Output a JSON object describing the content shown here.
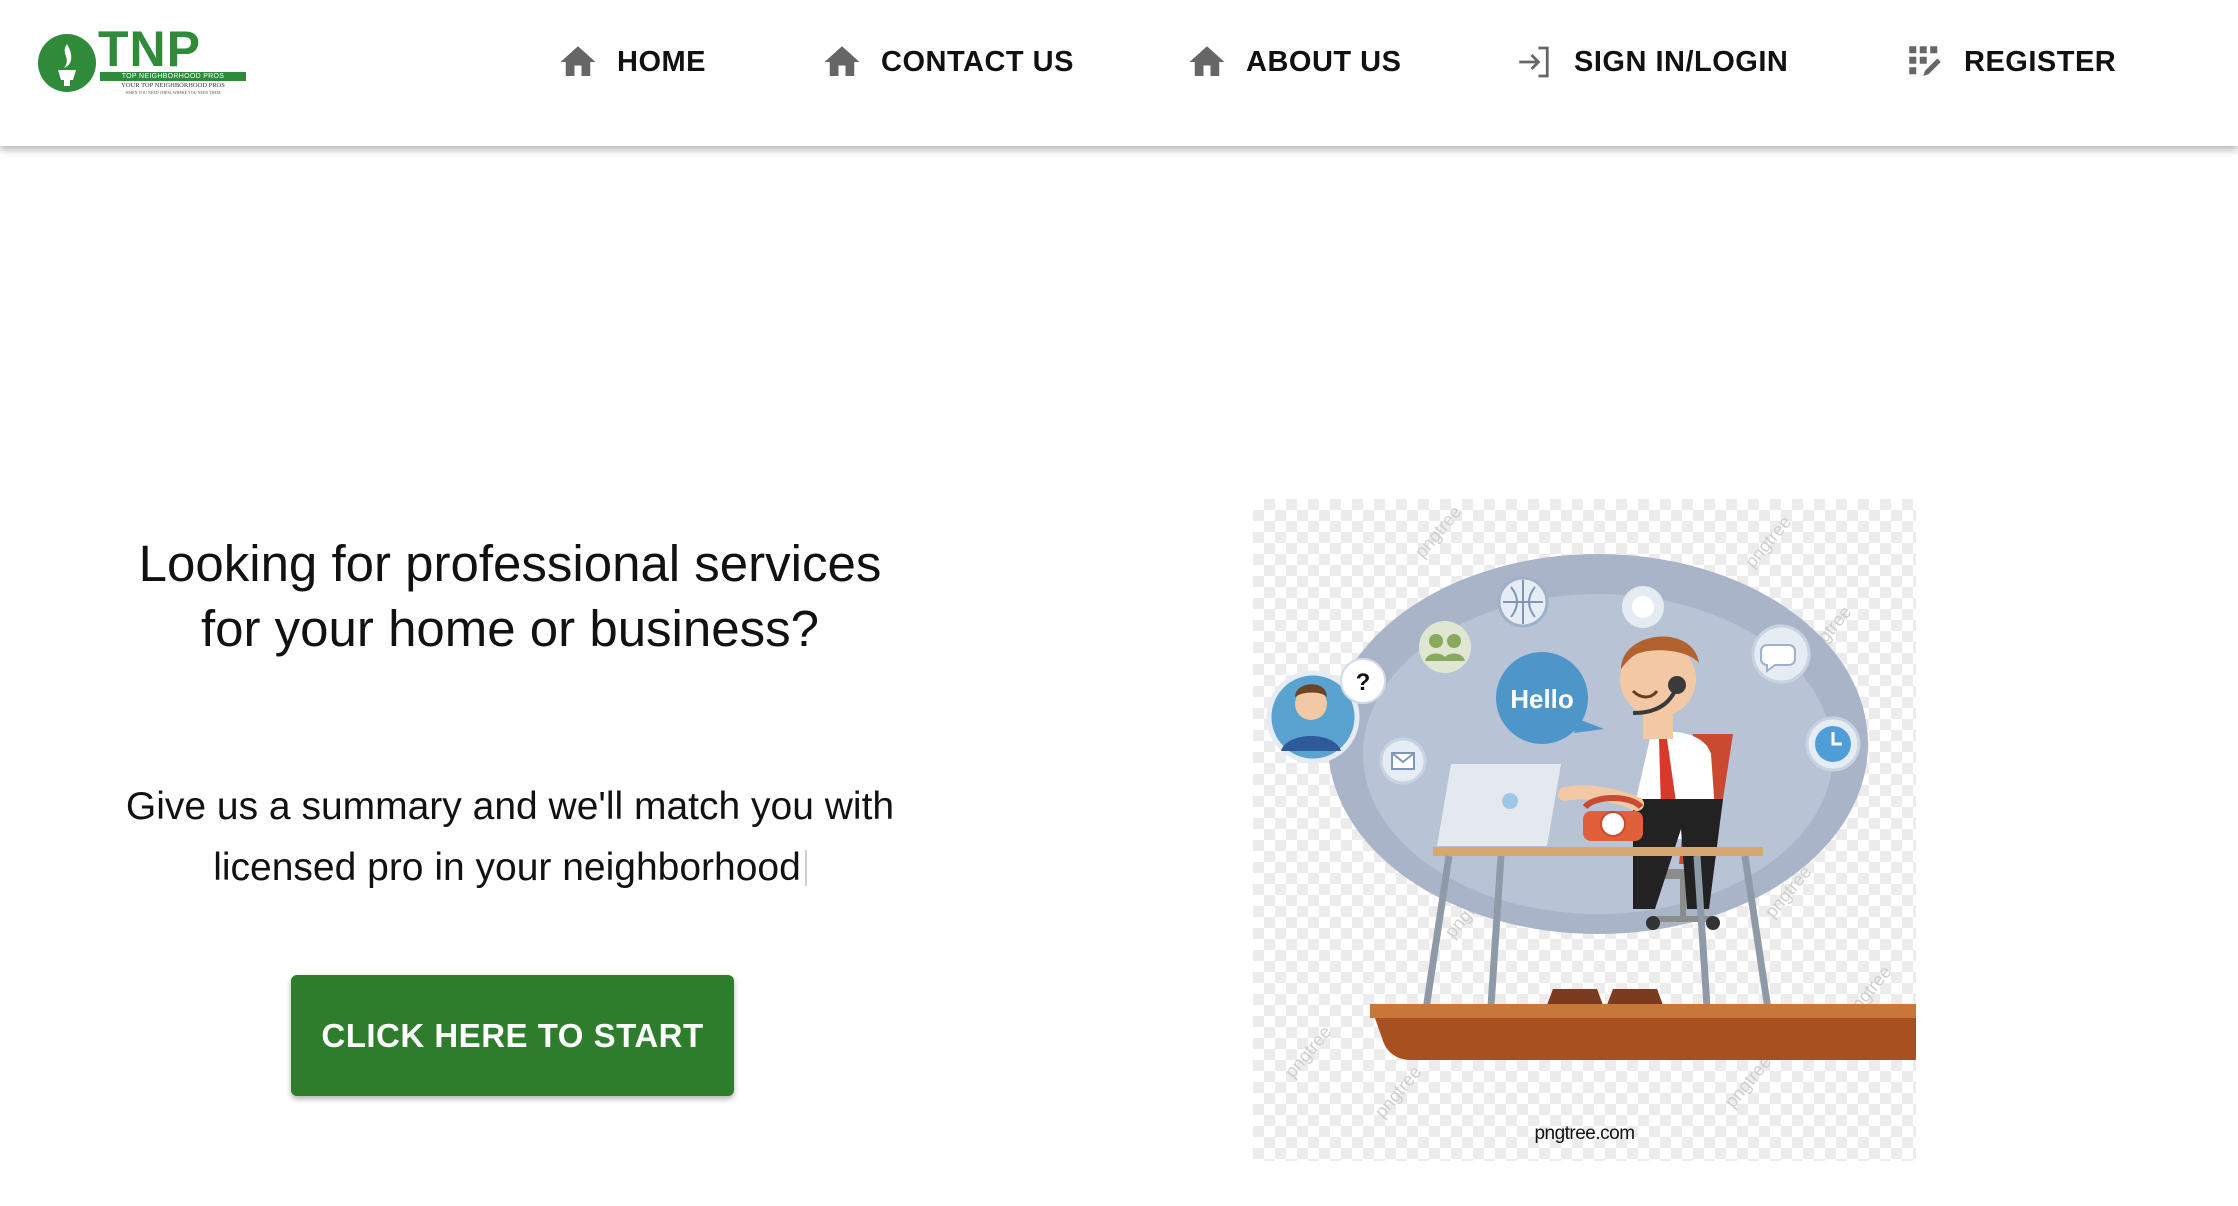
{
  "header": {
    "logo": {
      "wordmark": "TNP",
      "tagline": "TOP NEIGHBORHOOD PROS",
      "subtitle": "YOUR TOP NEIGHBORHOOD PROS",
      "slogan": "WHEN YOU NEED THEM, WHERE YOU NEED THEM",
      "brand_color": "#2f8a3a"
    },
    "nav": [
      {
        "label": "HOME",
        "icon": "home-icon"
      },
      {
        "label": "CONTACT US",
        "icon": "home-icon"
      },
      {
        "label": "ABOUT US",
        "icon": "home-icon"
      },
      {
        "label": "SIGN IN/LOGIN",
        "icon": "login-icon"
      },
      {
        "label": "REGISTER",
        "icon": "register-icon"
      }
    ]
  },
  "hero": {
    "heading": "Looking for professional services for your home or business?",
    "subtext": "Give us a summary and we'll match you with licensed pro in your neighborhood",
    "cta_label": "CLICK HERE TO START",
    "cta_color": "#2e7d2c"
  },
  "illustration": {
    "speech_bubble": "Hello",
    "question_mark": "?",
    "caption": "pngtree.com",
    "watermark": "pngtree"
  }
}
